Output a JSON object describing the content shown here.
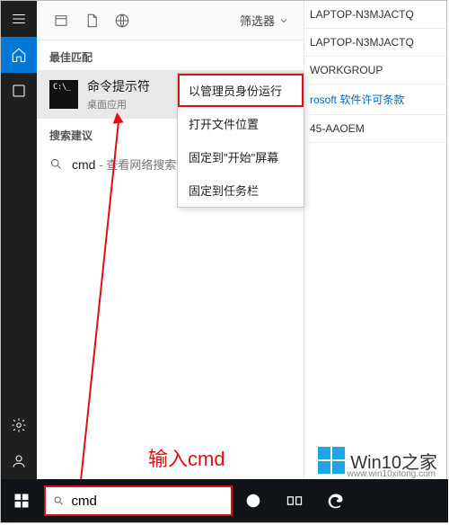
{
  "rightInfo": {
    "l1": "LAPTOP-N3MJACTQ",
    "l2": "LAPTOP-N3MJACTQ",
    "l3": "WORKGROUP",
    "link": "rosoft 软件许可条款",
    "l5": "45-AAOEM"
  },
  "header": {
    "filter": "筛选器"
  },
  "sections": {
    "best": "最佳匹配",
    "suggest": "搜索建议"
  },
  "bestMatch": {
    "icon": "C:\\_",
    "title": "命令提示符",
    "sub": "桌面应用"
  },
  "suggest": {
    "term": "cmd",
    "rest": "- 查看网络搜索结果"
  },
  "context": {
    "runAdmin": "以管理员身份运行",
    "openLoc": "打开文件位置",
    "pinStart": "固定到\"开始\"屏幕",
    "pinTask": "固定到任务栏"
  },
  "search": {
    "value": "cmd"
  },
  "annotation": {
    "text": "输入cmd"
  },
  "watermark": {
    "brand": "Win10之家",
    "url": "www.win10xitong.com"
  }
}
